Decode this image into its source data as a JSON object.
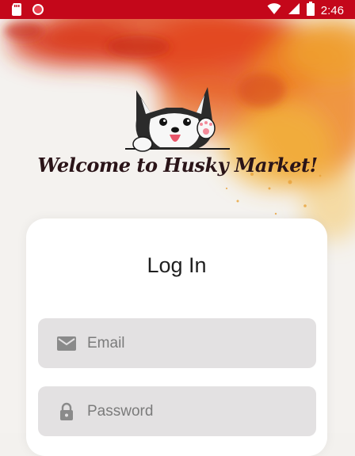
{
  "status_bar": {
    "time": "2:46",
    "icons": [
      "sd-card-icon",
      "record-icon",
      "wifi-icon",
      "signal-icon",
      "battery-icon"
    ]
  },
  "brand": {
    "welcome_text": "Welcome to Husky Market!",
    "logo": "husky-dog-logo"
  },
  "login": {
    "title": "Log In",
    "email": {
      "placeholder": "Email",
      "value": "",
      "icon": "mail-icon"
    },
    "password": {
      "placeholder": "Password",
      "value": "",
      "icon": "lock-icon"
    }
  },
  "colors": {
    "status_bar": "#c4071a",
    "paint_red": "#d8361a",
    "paint_orange": "#ee8a22",
    "paint_yellow": "#f2b53a",
    "field_bg": "#e3e1e2",
    "card_bg": "#ffffff",
    "welcome_text": "#2a1418"
  }
}
